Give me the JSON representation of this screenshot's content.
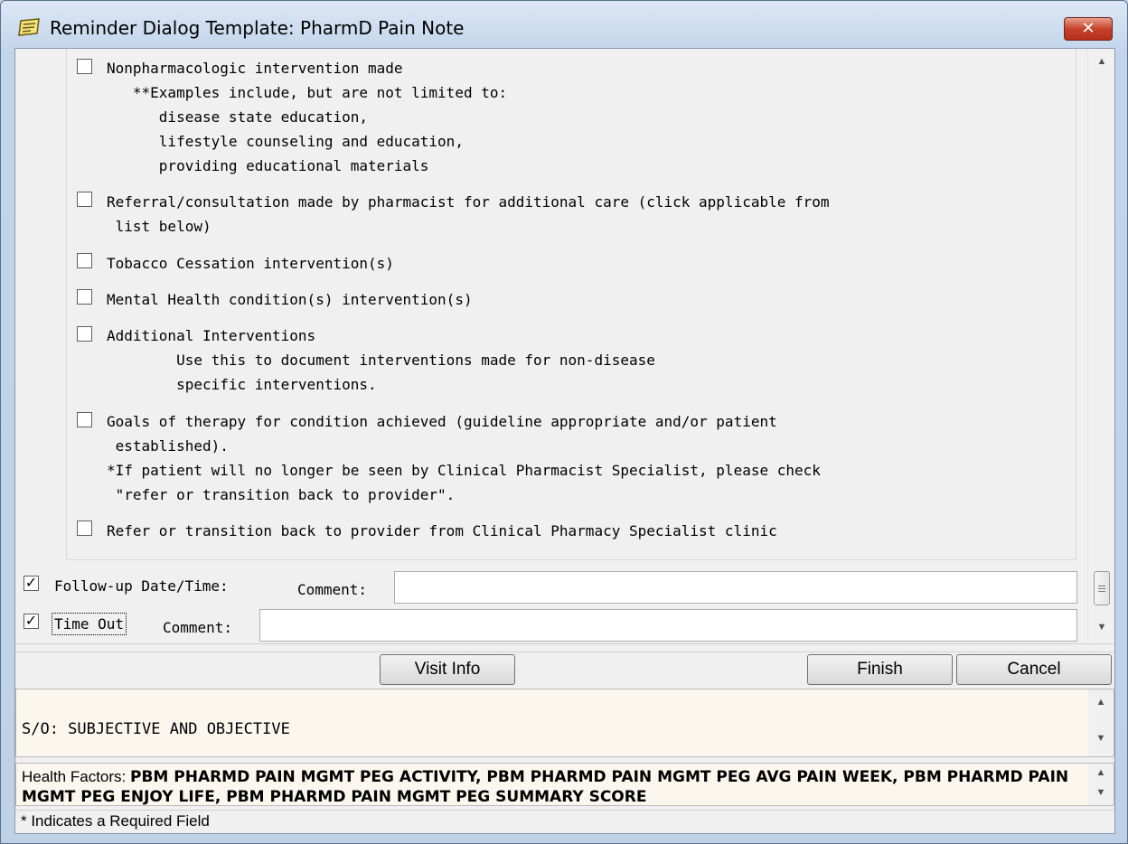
{
  "window": {
    "title": "Reminder Dialog Template: PharmD Pain Note",
    "close_label": "✕"
  },
  "items": [
    {
      "checked": false,
      "label": "Nonpharmacologic intervention made",
      "lines": [
        "   **Examples include, but are not limited to:",
        "      disease state education,",
        "      lifestyle counseling and education,",
        "      providing educational materials"
      ]
    },
    {
      "checked": false,
      "label": "Referral/consultation made by pharmacist for additional care (click applicable from",
      "lines": [
        " list below)"
      ]
    },
    {
      "checked": false,
      "label": "Tobacco Cessation intervention(s)",
      "lines": []
    },
    {
      "checked": false,
      "label": "Mental Health condition(s) intervention(s)",
      "lines": []
    },
    {
      "checked": false,
      "label": "Additional Interventions",
      "lines": [
        "        Use this to document interventions made for non-disease",
        "        specific interventions."
      ]
    },
    {
      "checked": false,
      "label": "Goals of therapy for condition achieved (guideline appropriate and/or patient",
      "lines": [
        " established).",
        "*If patient will no longer be seen by Clinical Pharmacist Specialist, please check",
        " \"refer or transition back to provider\"."
      ]
    },
    {
      "checked": false,
      "label": "Refer or transition back to provider from Clinical Pharmacy Specialist clinic",
      "lines": []
    }
  ],
  "followup": {
    "checked": true,
    "label": "Follow-up Date/Time:",
    "comment_label": "Comment:",
    "comment_value": ""
  },
  "timeout": {
    "checked": true,
    "label": "Time Out",
    "comment_label": "Comment:",
    "comment_value": ""
  },
  "buttons": {
    "visit_info": "Visit Info",
    "finish": "Finish",
    "cancel": "Cancel"
  },
  "preview": {
    "text": "S/O: SUBJECTIVE AND OBJECTIVE"
  },
  "health_factors": {
    "label": "Health Factors:",
    "value": "PBM PHARMD PAIN MGMT PEG ACTIVITY, PBM PHARMD PAIN MGMT PEG AVG PAIN WEEK, PBM PHARMD PAIN MGMT PEG ENJOY LIFE, PBM PHARMD PAIN MGMT PEG SUMMARY SCORE"
  },
  "status": {
    "text": "* Indicates a Required Field"
  },
  "glyphs": {
    "check": "✓",
    "up": "▲",
    "down": "▼"
  }
}
